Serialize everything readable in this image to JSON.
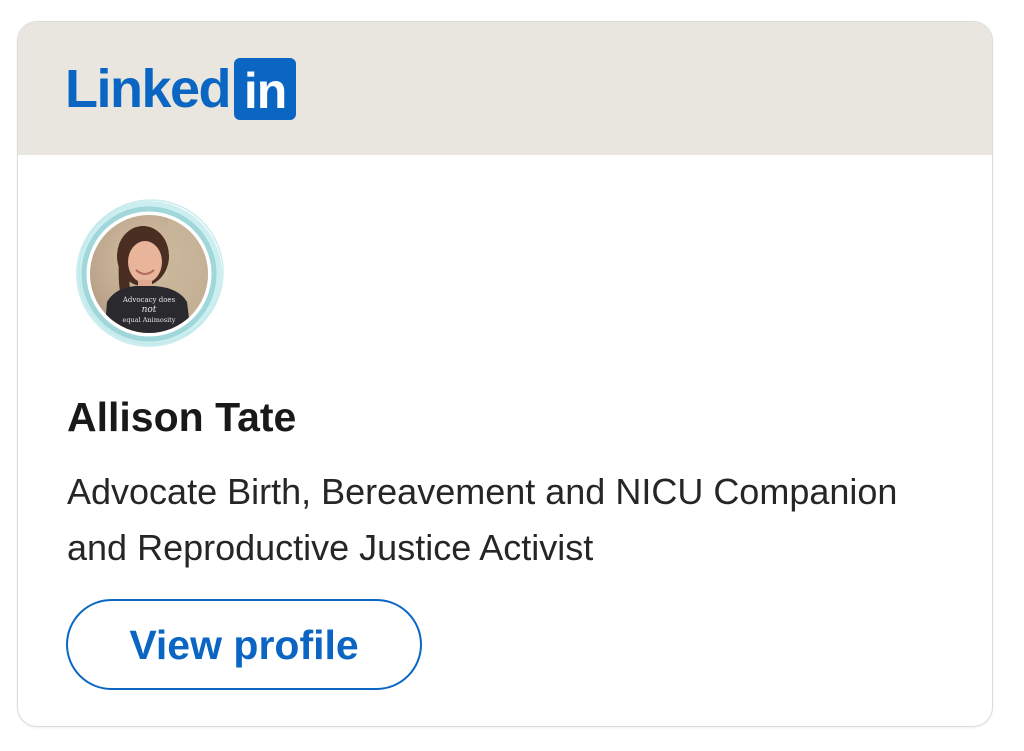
{
  "logo": {
    "word": "Linked",
    "box_text": "in",
    "brand_color": "#0a66c2"
  },
  "profile": {
    "name": "Allison Tate",
    "headline": "Advocate Birth, Bereavement and NICU Companion and Reproductive Justice Activist",
    "shirt_text_line1": "Advocacy does",
    "shirt_text_line2": "not",
    "shirt_text_line3": "equal Animosity"
  },
  "actions": {
    "view_profile_label": "View profile"
  },
  "colors": {
    "header_bg": "#e9e5df",
    "card_border": "#dcdcdc",
    "name_text": "#191919",
    "body_text": "#262626",
    "avatar_ring": "#8fd0d4"
  }
}
